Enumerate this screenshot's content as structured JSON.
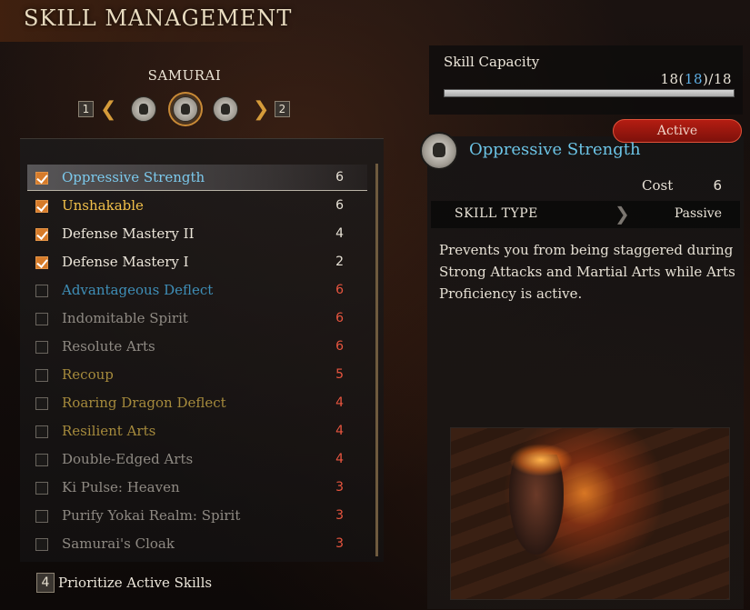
{
  "header": {
    "title": "SKILL MANAGEMENT"
  },
  "class_selector": {
    "current_class": "SAMURAI",
    "prev_key": "1",
    "next_key": "2",
    "icons": [
      "samurai-class-icon-left",
      "samurai-class-icon-selected",
      "samurai-class-icon-right"
    ]
  },
  "skills": [
    {
      "name": "Oppressive Strength",
      "cost": "6",
      "equipped": true,
      "selected": true,
      "name_color": "#7cc9ec",
      "cost_color": "#e8e2d6"
    },
    {
      "name": "Unshakable",
      "cost": "6",
      "equipped": true,
      "selected": false,
      "name_color": "#f2c04a",
      "cost_color": "#e8e2d6"
    },
    {
      "name": "Defense Mastery II",
      "cost": "4",
      "equipped": true,
      "selected": false,
      "name_color": "#ece6da",
      "cost_color": "#e8e2d6"
    },
    {
      "name": "Defense Mastery I",
      "cost": "2",
      "equipped": true,
      "selected": false,
      "name_color": "#ece6da",
      "cost_color": "#e8e2d6"
    },
    {
      "name": "Advantageous Deflect",
      "cost": "6",
      "equipped": false,
      "selected": false,
      "name_color": "#3f8fb8",
      "cost_color": "#e8553f"
    },
    {
      "name": "Indomitable Spirit",
      "cost": "6",
      "equipped": false,
      "selected": false,
      "name_color": "#8f8a83",
      "cost_color": "#e8553f"
    },
    {
      "name": "Resolute Arts",
      "cost": "6",
      "equipped": false,
      "selected": false,
      "name_color": "#8f8a83",
      "cost_color": "#e8553f"
    },
    {
      "name": "Recoup",
      "cost": "5",
      "equipped": false,
      "selected": false,
      "name_color": "#a58a3c",
      "cost_color": "#e8553f"
    },
    {
      "name": "Roaring Dragon Deflect",
      "cost": "4",
      "equipped": false,
      "selected": false,
      "name_color": "#a58a3c",
      "cost_color": "#e8553f"
    },
    {
      "name": "Resilient Arts",
      "cost": "4",
      "equipped": false,
      "selected": false,
      "name_color": "#a58a3c",
      "cost_color": "#e8553f"
    },
    {
      "name": "Double-Edged Arts",
      "cost": "4",
      "equipped": false,
      "selected": false,
      "name_color": "#8f8a83",
      "cost_color": "#e8553f"
    },
    {
      "name": "Ki Pulse: Heaven",
      "cost": "3",
      "equipped": false,
      "selected": false,
      "name_color": "#8f8a83",
      "cost_color": "#e8553f"
    },
    {
      "name": "Purify Yokai Realm: Spirit",
      "cost": "3",
      "equipped": false,
      "selected": false,
      "name_color": "#8f8a83",
      "cost_color": "#e8553f"
    },
    {
      "name": "Samurai's Cloak",
      "cost": "3",
      "equipped": false,
      "selected": false,
      "name_color": "#8f8a83",
      "cost_color": "#e8553f"
    }
  ],
  "footer": {
    "key": "4",
    "label": "Prioritize Active Skills"
  },
  "capacity": {
    "label": "Skill Capacity",
    "used": "18",
    "highlight": "18",
    "max": "18",
    "fill_fraction": 1.0
  },
  "details": {
    "status": "Active",
    "name": "Oppressive Strength",
    "cost_label": "Cost",
    "cost_value": "6",
    "type_label": "SKILL TYPE",
    "type_value": "Passive",
    "description": "Prevents you from being staggered during Strong Attacks and Martial Arts while Arts Proficiency is active."
  },
  "colors": {
    "accent_orange": "#d67b2a",
    "highlight_blue": "#6cc4e6",
    "cost_red": "#e8553f",
    "active_red": "#b41d12"
  }
}
